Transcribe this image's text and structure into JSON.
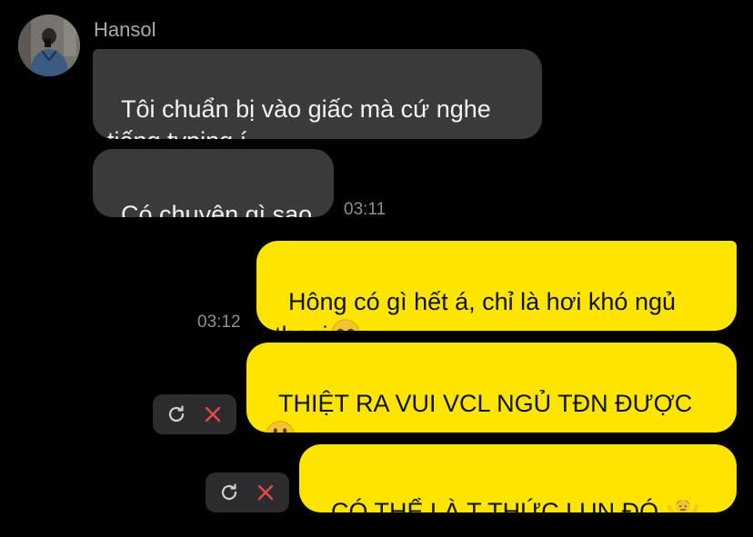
{
  "chat": {
    "sender_name": "Hansol",
    "messages": [
      {
        "direction": "in",
        "text": "Tôi chuẩn bị vào giấc mà cứ nghe\ntiếng typing í"
      },
      {
        "direction": "in",
        "text": "Có chuyện gì sao",
        "time": "03:11"
      },
      {
        "direction": "out",
        "text": "Hông có gì hết á, chỉ là hơi khó ngủ\nthoai",
        "emoji": "smiling-face-icon",
        "time": "03:12"
      },
      {
        "direction": "out",
        "text": "THIỆT RA VUI VCL NGỦ TĐN ĐƯỢC\n",
        "emoji": "grinning-face-icon",
        "status": "failed"
      },
      {
        "direction": "out",
        "text": "CÓ THỂ LÀ T THỨC LUN ĐÓ ",
        "emoji": "person-shrugging-icon",
        "status": "failed"
      }
    ]
  },
  "colors": {
    "background": "#000000",
    "incoming_bubble": "#3a3a3c",
    "outgoing_bubble": "#fde500",
    "timestamp": "#8e8e93",
    "retry_icon": "#d0d0d0",
    "delete_icon": "#e5484d"
  }
}
